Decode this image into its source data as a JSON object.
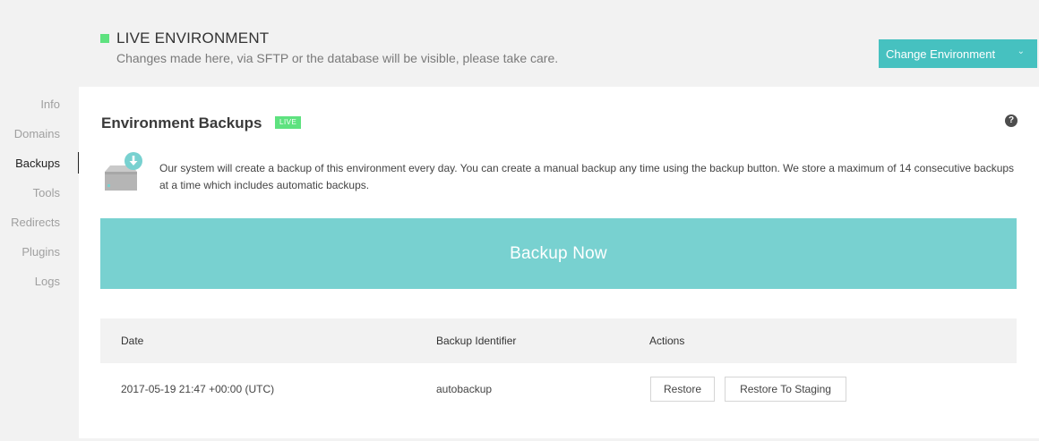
{
  "header": {
    "indicator_color": "#5ee27f",
    "title": "LIVE ENVIRONMENT",
    "subtitle": "Changes made here, via SFTP or the database will be visible, please take care.",
    "change_button_label": "Change Environment",
    "change_button_icon": "chevron-down-icon"
  },
  "sidebar": {
    "items": [
      {
        "label": "Info",
        "active": false
      },
      {
        "label": "Domains",
        "active": false
      },
      {
        "label": "Backups",
        "active": true
      },
      {
        "label": "Tools",
        "active": false
      },
      {
        "label": "Redirects",
        "active": false
      },
      {
        "label": "Plugins",
        "active": false
      },
      {
        "label": "Logs",
        "active": false
      }
    ]
  },
  "panel": {
    "title": "Environment Backups",
    "badge": "LIVE",
    "help_icon": "question-circle-icon",
    "illustration_icon": "server-download-icon",
    "description": "Our system will create a backup of this environment every day. You can create a manual backup any time using the backup button. We store a maximum of 14 consecutive backups at a time which includes automatic backups.",
    "backup_button_label": "Backup Now"
  },
  "table": {
    "headers": [
      "Date",
      "Backup Identifier",
      "Actions"
    ],
    "rows": [
      {
        "date": "2017-05-19 21:47 +00:00 (UTC)",
        "identifier": "autobackup",
        "actions": [
          "Restore",
          "Restore To Staging"
        ]
      }
    ]
  },
  "colors": {
    "accent": "#46c1c0",
    "backup_button": "#78d1d0",
    "live_green": "#5ee27f"
  }
}
